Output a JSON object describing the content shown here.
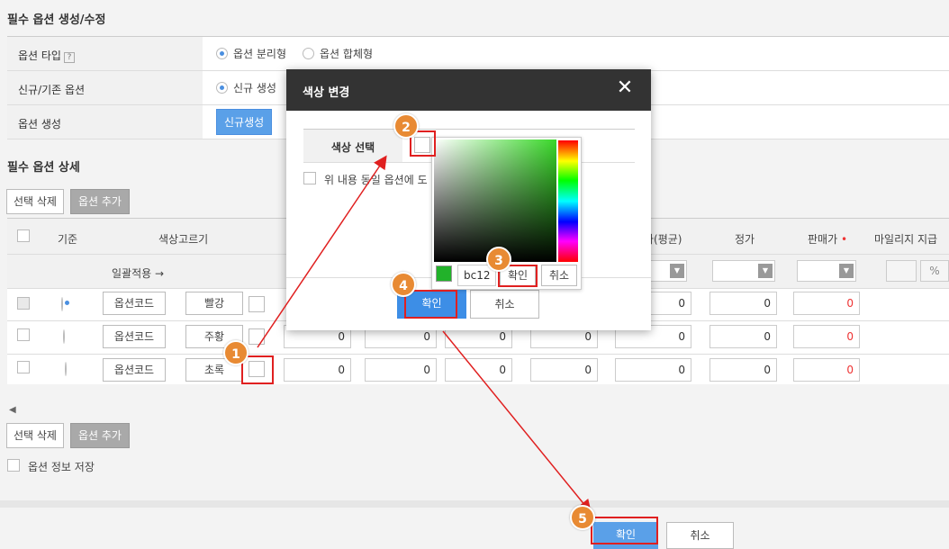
{
  "section1": {
    "title": "필수 옵션 생성/수정",
    "rows": [
      {
        "label": "옵션 타입",
        "help": "?",
        "options": [
          "옵션 분리형",
          "옵션 합체형"
        ],
        "selected": 0
      },
      {
        "label": "신규/기존 옵션",
        "options": [
          "신규 생성"
        ],
        "selected": 0
      },
      {
        "label": "옵션 생성",
        "button": "신규생성"
      }
    ]
  },
  "section2": {
    "title": "필수 옵션 상세",
    "delete_btn": "선택 삭제",
    "add_btn": "옵션 추가",
    "headers": {
      "base": "기준",
      "color": "색상고르기",
      "avg": "가(평균)",
      "price": "정가",
      "sale": "판매가",
      "sale_star": "•",
      "mileage": "마일리지 지급"
    },
    "batch_label": "일괄적용 →",
    "percent": "%",
    "rows": [
      {
        "code_btn": "옵션코드",
        "color_name": "빨강",
        "values": [
          "0",
          "0",
          "0"
        ]
      },
      {
        "code_btn": "옵션코드",
        "color_name": "주황",
        "values": [
          "0",
          "0",
          "0",
          "0",
          "0",
          "0",
          "0"
        ]
      },
      {
        "code_btn": "옵션코드",
        "color_name": "초록",
        "values": [
          "0",
          "0",
          "0",
          "0",
          "0",
          "0",
          "0"
        ]
      }
    ],
    "scroll_left": "◀",
    "save_option": "옵션 정보 저장"
  },
  "footer": {
    "confirm": "확인",
    "cancel": "취소"
  },
  "modal": {
    "title": "색상 변경",
    "close": "✕",
    "color_select_label": "색상 선택",
    "apply_same": "위 내용 동일 옵션에 도",
    "confirm": "확인",
    "cancel": "취소"
  },
  "picker": {
    "hex_value": "bc12",
    "current_color": "#22b22a",
    "confirm": "확인",
    "cancel": "취소"
  },
  "badges": [
    "1",
    "2",
    "3",
    "4",
    "5"
  ],
  "colors": {
    "accent": "#4a8fe0",
    "annotation": "#e02020",
    "badge": "#e88a33"
  }
}
